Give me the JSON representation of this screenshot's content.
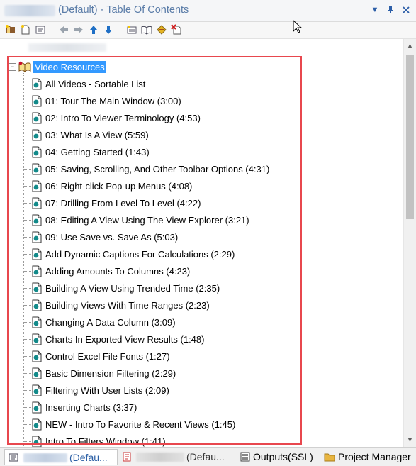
{
  "window": {
    "title": "(Default) - Table Of Contents",
    "controls": [
      "pin-dropdown",
      "pin",
      "close"
    ]
  },
  "toolbar": {
    "buttons": [
      "new-book",
      "new-page",
      "properties",
      "move-left",
      "move-right",
      "move-up",
      "move-down",
      "insert-heading",
      "open-book",
      "insert-link",
      "delete"
    ]
  },
  "tree": {
    "root_label": "Video Resources",
    "items": [
      {
        "label": "All Videos - Sortable List"
      },
      {
        "label": "01: Tour The Main Window (3:00)"
      },
      {
        "label": "02: Intro To Viewer Terminology (4:53)"
      },
      {
        "label": "03: What Is A View (5:59)"
      },
      {
        "label": "04: Getting Started (1:43)"
      },
      {
        "label": "05: Saving, Scrolling, And Other Toolbar Options (4:31)"
      },
      {
        "label": "06: Right-click Pop-up Menus (4:08)"
      },
      {
        "label": "07: Drilling From Level To Level (4:22)"
      },
      {
        "label": "08: Editing A View Using The View Explorer (3:21)"
      },
      {
        "label": "09: Use Save vs. Save As (5:03)"
      },
      {
        "label": "Add Dynamic Captions For Calculations (2:29)"
      },
      {
        "label": "Adding Amounts To Columns (4:23)"
      },
      {
        "label": "Building A View Using Trended Time (2:35)"
      },
      {
        "label": "Building Views With Time Ranges (2:23)"
      },
      {
        "label": "Changing A Data Column (3:09)"
      },
      {
        "label": "Charts In Exported View Results (1:48)"
      },
      {
        "label": "Control Excel File Fonts (1:27)"
      },
      {
        "label": "Basic Dimension Filtering (2:29)"
      },
      {
        "label": "Filtering With User Lists (2:09)"
      },
      {
        "label": "Inserting Charts (3:37)"
      },
      {
        "label": "NEW - Intro To Favorite & Recent Views (1:45)"
      },
      {
        "label": "Intro To Filters Window (1:41)"
      }
    ]
  },
  "tabs": [
    {
      "label": "(Defau..."
    },
    {
      "label": "(Defau..."
    },
    {
      "label": "Outputs(SSL)"
    },
    {
      "label": "Project Manager"
    }
  ],
  "colors": {
    "selection": "#3399ff",
    "highlight_box": "#e8474e",
    "title_text": "#5a7ca8"
  }
}
